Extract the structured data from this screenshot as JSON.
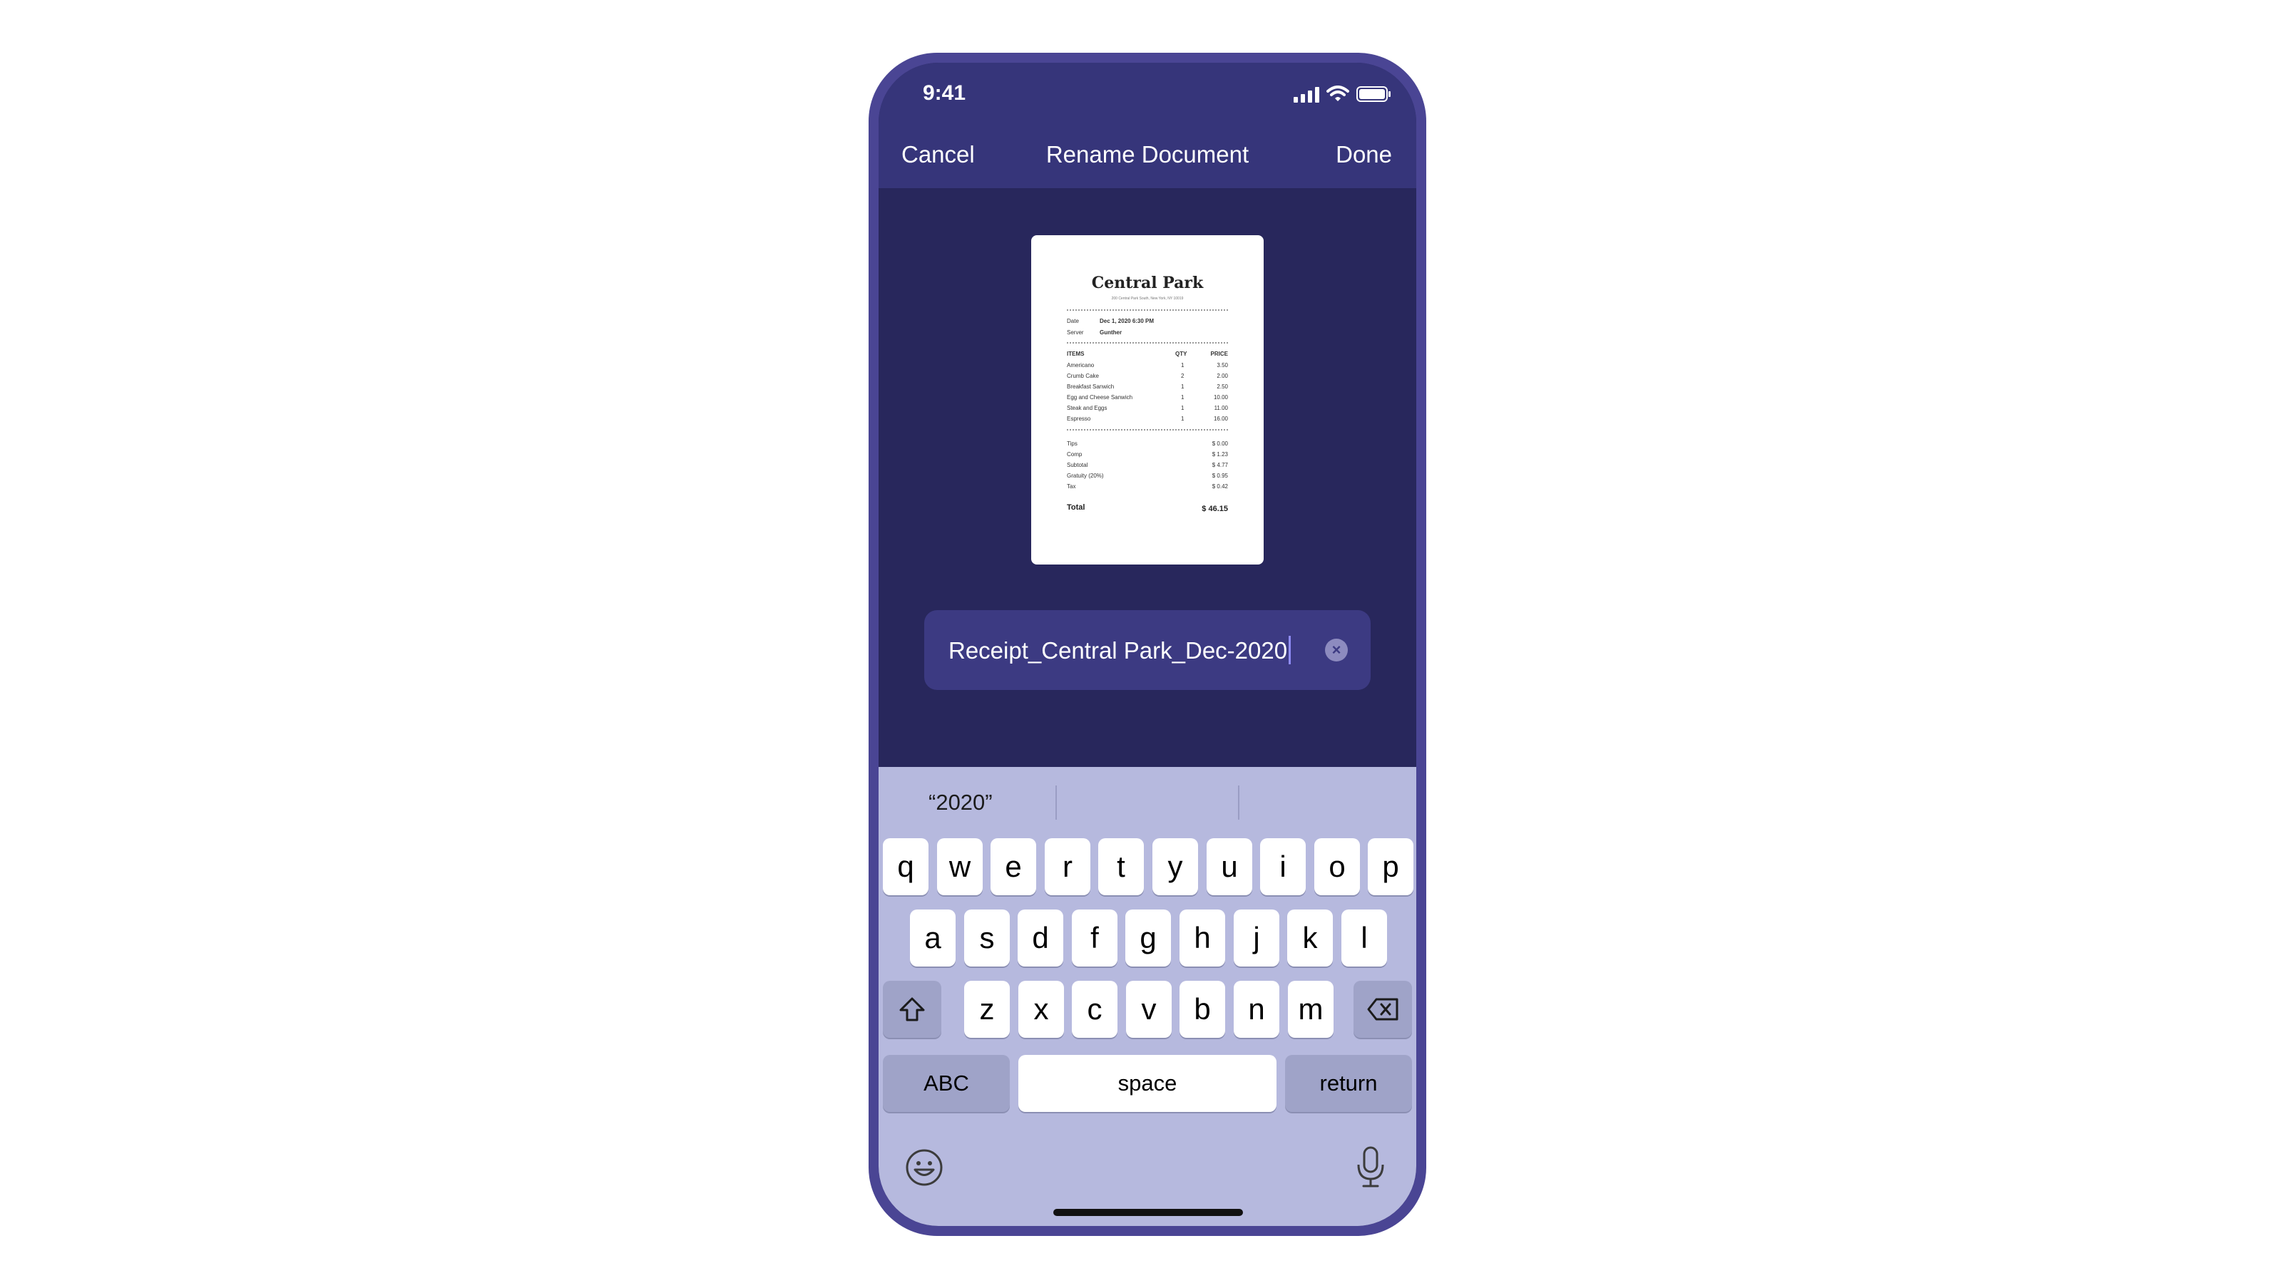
{
  "status": {
    "time": "9:41"
  },
  "nav": {
    "cancel": "Cancel",
    "title": "Rename Document",
    "done": "Done"
  },
  "receipt": {
    "title": "Central Park",
    "address": "200 Central Park South, New York, NY 10019",
    "date_label": "Date",
    "date_value": "Dec 1, 2020 6:30 PM",
    "server_label": "Server",
    "server_value": "Gunther",
    "headers": [
      "ITEMS",
      "QTY",
      "PRICE"
    ],
    "items": [
      {
        "name": "Americano",
        "qty": "1",
        "price": "3.50"
      },
      {
        "name": "Crumb Cake",
        "qty": "2",
        "price": "2.00"
      },
      {
        "name": "Breakfast Sanwich",
        "qty": "1",
        "price": "2.50"
      },
      {
        "name": "Egg and Cheese Sanwich",
        "qty": "1",
        "price": "10.00"
      },
      {
        "name": "Steak and Eggs",
        "qty": "1",
        "price": "11.00"
      },
      {
        "name": "Espresso",
        "qty": "1",
        "price": "16.00"
      }
    ],
    "summary": [
      {
        "label": "Tips",
        "value": "$ 0.00"
      },
      {
        "label": "Comp",
        "value": "$ 1.23"
      },
      {
        "label": "Subtotal",
        "value": "$ 4.77"
      },
      {
        "label": "Gratuity (20%)",
        "value": "$ 0.95"
      },
      {
        "label": "Tax",
        "value": "$ 0.42"
      }
    ],
    "total_label": "Total",
    "total_value": "$ 46.15"
  },
  "field": {
    "value": "Receipt_Central Park_Dec-2020",
    "clear_icon": "clear-circle-icon"
  },
  "keyboard": {
    "suggestions": [
      "“2020”",
      "",
      ""
    ],
    "row1": [
      "q",
      "w",
      "e",
      "r",
      "t",
      "y",
      "u",
      "i",
      "o",
      "p"
    ],
    "row2": [
      "a",
      "s",
      "d",
      "f",
      "g",
      "h",
      "j",
      "k",
      "l"
    ],
    "row3": [
      "z",
      "x",
      "c",
      "v",
      "b",
      "n",
      "m"
    ],
    "abc": "ABC",
    "space": "space",
    "return": "return",
    "icons": {
      "shift": "shift-icon",
      "delete": "delete-icon",
      "emoji": "emoji-icon",
      "mic": "microphone-icon"
    }
  }
}
